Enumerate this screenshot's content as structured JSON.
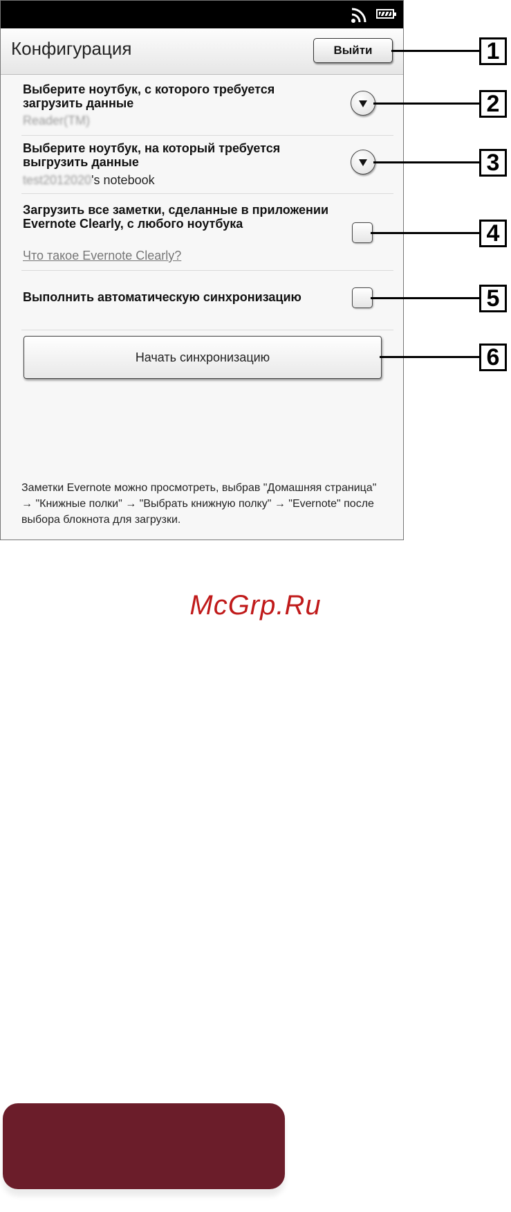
{
  "header": {
    "title": "Конфигурация",
    "exit_label": "Выйти"
  },
  "rows": [
    {
      "label": "Выберите ноутбук, с которого требуется загрузить данные",
      "value_masked": "Reader(TM)",
      "value_suffix": ""
    },
    {
      "label": "Выберите ноутбук, на который требуется выгрузить данные",
      "value_masked": "test2012020",
      "value_suffix": "'s notebook"
    },
    {
      "label": "Загрузить все заметки, сделанные в приложении Evernote Clearly, с любого ноутбука",
      "link": "Что такое Evernote Clearly?"
    },
    {
      "label": "Выполнить автоматическую синхронизацию"
    }
  ],
  "sync_button_label": "Начать синхронизацию",
  "footer_note": "Заметки Evernote можно просмотреть, выбрав \"Домашняя страница\" → \"Книжные полки\" → \"Выбрать книжную полку\" → \"Evernote\" после выбора блокнота для загрузки.",
  "callouts": [
    "1",
    "2",
    "3",
    "4",
    "5",
    "6"
  ],
  "watermark": "McGrp.Ru",
  "colors": {
    "watermark": "#c01a1a",
    "footer_tab": "#6b1d2a"
  }
}
